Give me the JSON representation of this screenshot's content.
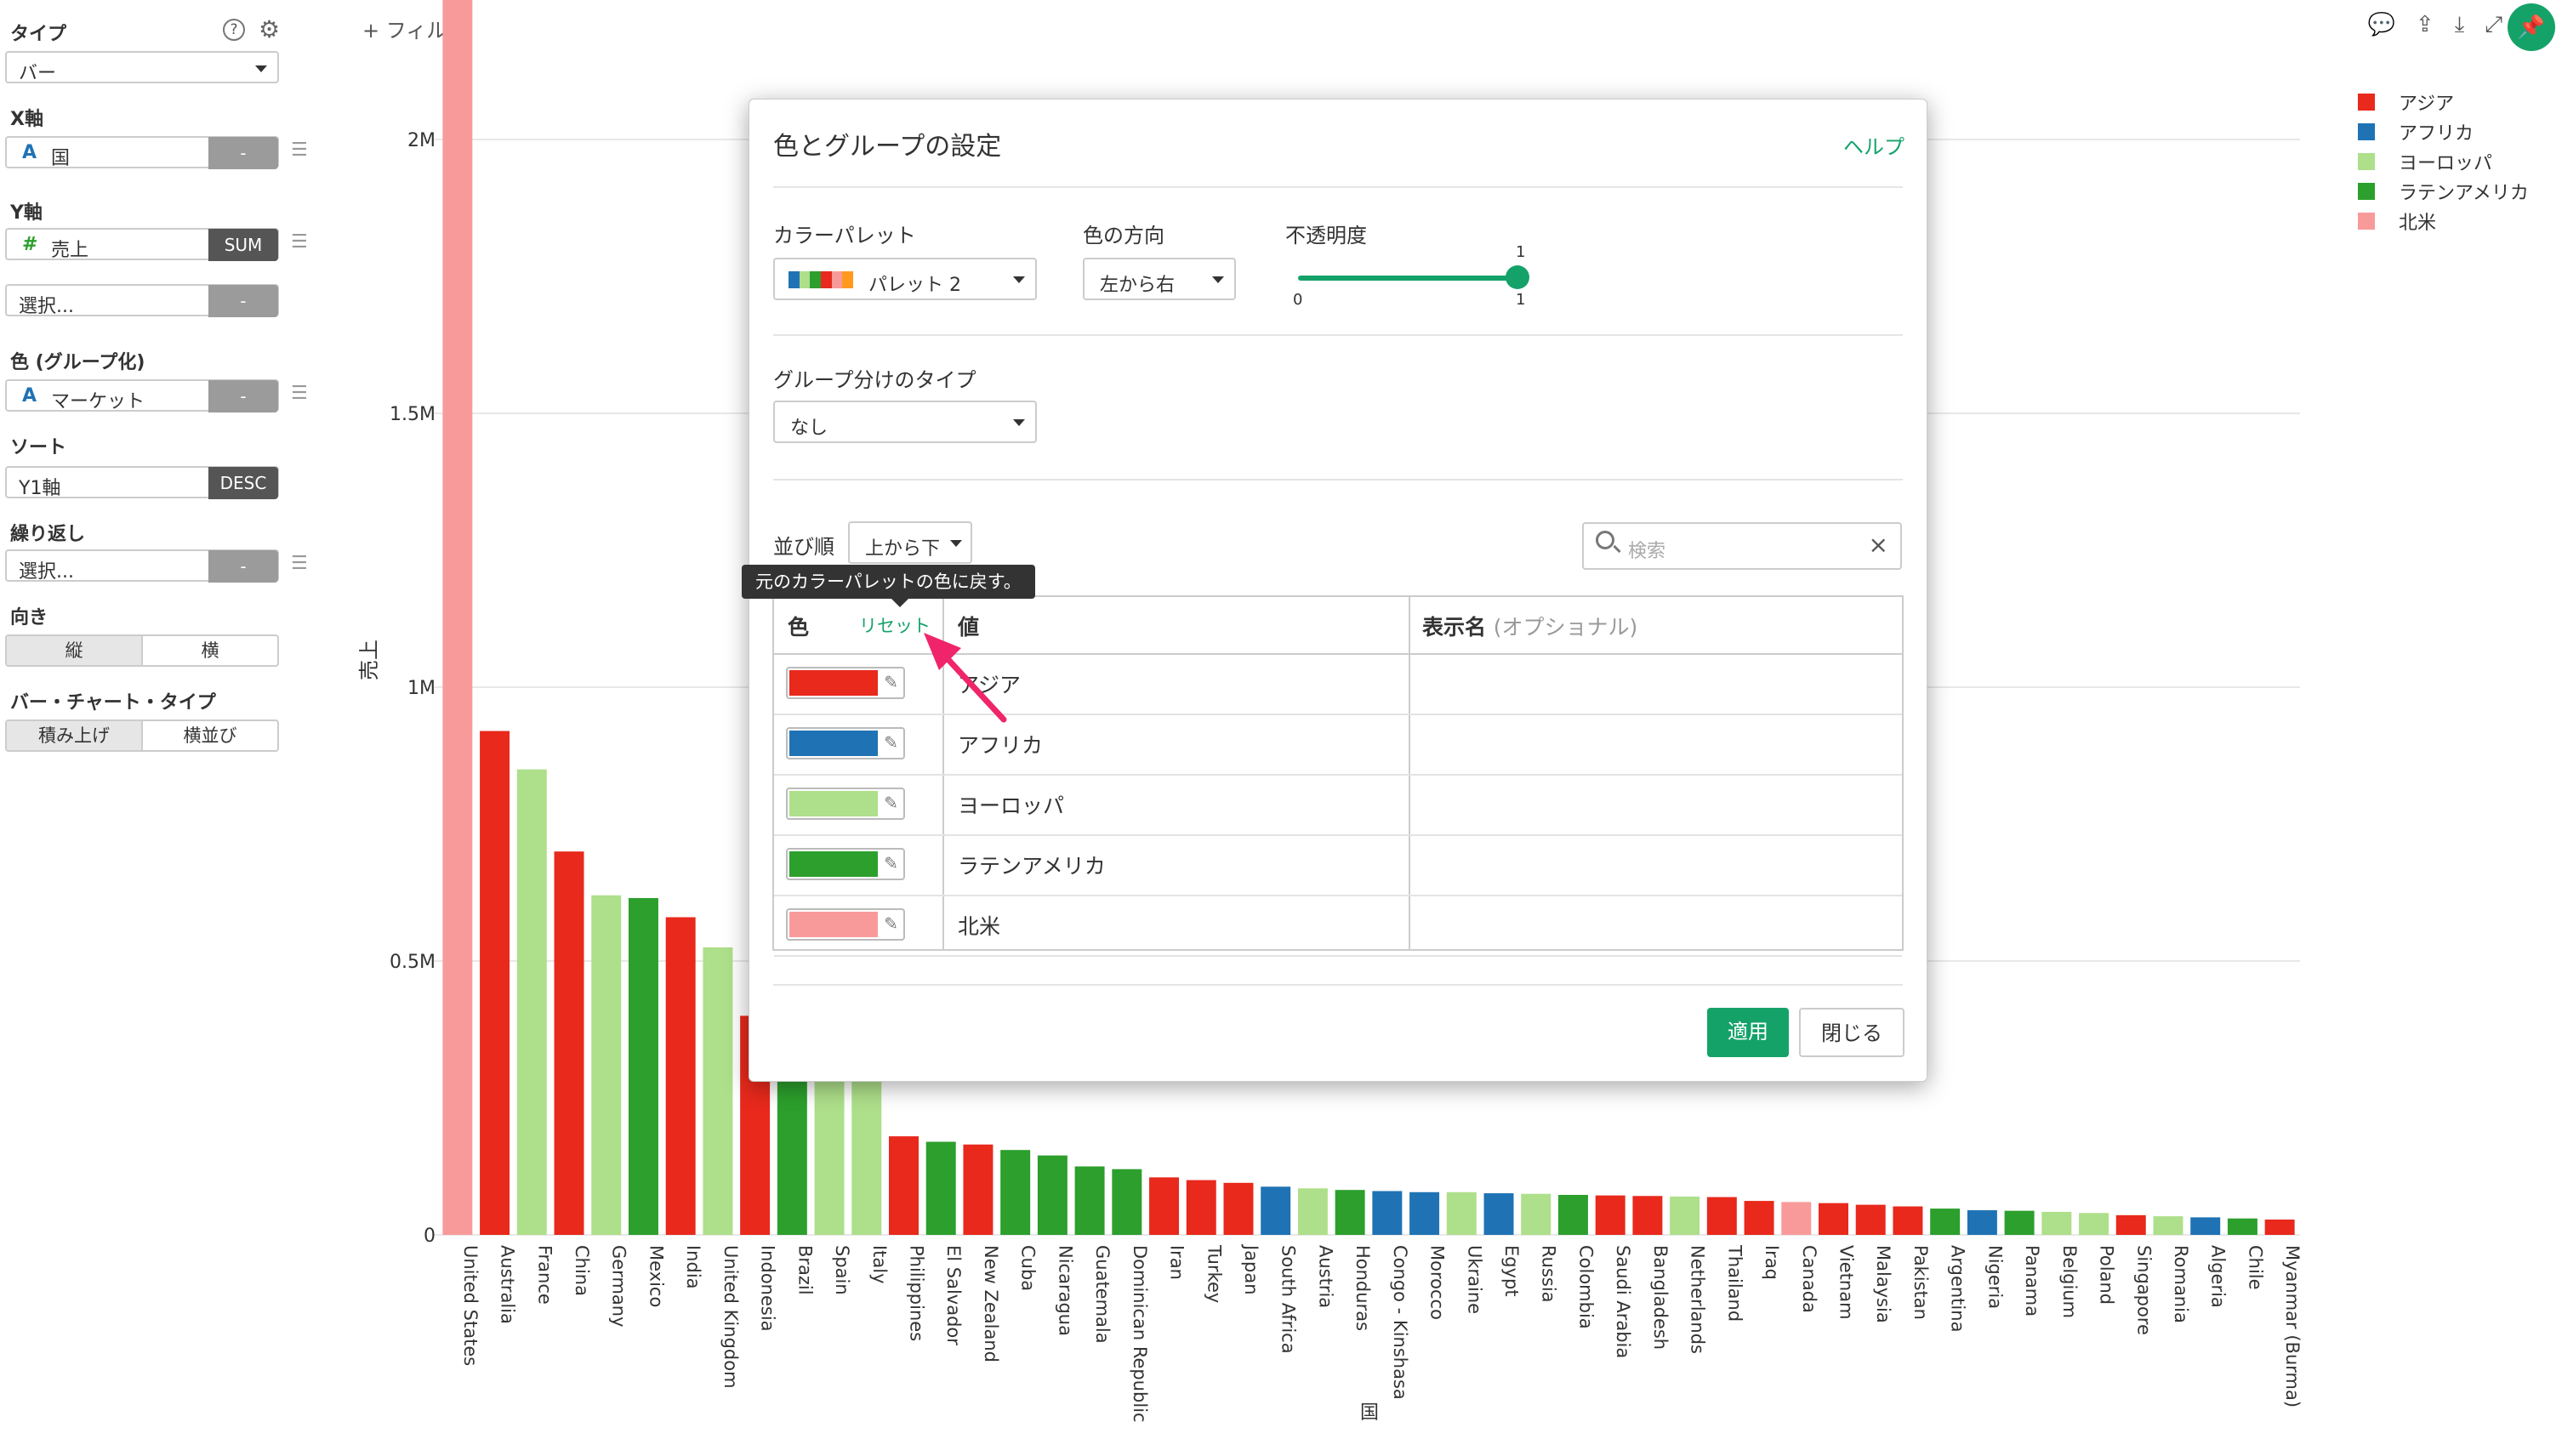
{
  "sidebar": {
    "type_label": "タイプ",
    "type_value": "バー",
    "help_icon": "?",
    "x_label": "X軸",
    "x_field": {
      "glyph": "A",
      "text": "国",
      "btn": "-"
    },
    "y_label": "Y軸",
    "y_field": {
      "glyph": "#",
      "text": "売上",
      "btn": "SUM"
    },
    "y2_field": {
      "text": "選択...",
      "btn": "-"
    },
    "color_label": "色 (グループ化)",
    "color_field": {
      "glyph": "A",
      "text": "マーケット",
      "btn": "-"
    },
    "sort_label": "ソート",
    "sort_field": {
      "text": "Y1軸",
      "btn": "DESC"
    },
    "repeat_label": "繰り返し",
    "repeat_field": {
      "text": "選択...",
      "btn": "-"
    },
    "orient_label": "向き",
    "orient_opts": [
      "縦",
      "横"
    ],
    "bartype_label": "バー・チャート・タイプ",
    "bartype_opts": [
      "積み上げ",
      "横並び"
    ]
  },
  "topbar": {
    "filter": "+ フィルタ"
  },
  "legend": [
    {
      "name": "アジア",
      "color": "#e8291c"
    },
    {
      "name": "アフリカ",
      "color": "#1f73b4"
    },
    {
      "name": "ヨーロッパ",
      "color": "#aedf8a"
    },
    {
      "name": "ラテンアメリカ",
      "color": "#2c9f2c"
    },
    {
      "name": "北米",
      "color": "#f99a9a"
    }
  ],
  "modal": {
    "title": "色とグループの設定",
    "help": "ヘルプ",
    "palette_label": "カラーパレット",
    "palette_value": "パレット 2",
    "palette_colors": [
      "#1f73b4",
      "#aedf8a",
      "#2c9f2c",
      "#e8291c",
      "#f99a9a",
      "#ff9a1f"
    ],
    "direction_label": "色の方向",
    "direction_value": "左から右",
    "opacity_label": "不透明度",
    "opacity_min": "0",
    "opacity_max": "1",
    "opacity_value": "1",
    "group_label": "グループ分けのタイプ",
    "group_value": "なし",
    "order_label": "並び順",
    "order_value": "上から下",
    "search_placeholder": "検索",
    "tooltip": "元のカラーパレットの色に戻す。",
    "table": {
      "col_color": "色",
      "reset": "リセット",
      "col_value": "値",
      "col_display": "表示名",
      "col_display_opt": "(オプショナル)",
      "rows": [
        {
          "color": "#e8291c",
          "value": "アジア"
        },
        {
          "color": "#1f73b4",
          "value": "アフリカ"
        },
        {
          "color": "#aedf8a",
          "value": "ヨーロッパ"
        },
        {
          "color": "#2c9f2c",
          "value": "ラテンアメリカ"
        },
        {
          "color": "#f99a9a",
          "value": "北米"
        }
      ]
    },
    "apply": "適用",
    "close": "閉じる"
  },
  "chart_data": {
    "type": "bar",
    "ylabel": "売上",
    "xlabel": "国",
    "yticks": [
      "0",
      "0.5M",
      "1M",
      "1.5M",
      "2M"
    ],
    "ylim": [
      0,
      2500000
    ],
    "categories": [
      "United States",
      "Australia",
      "France",
      "China",
      "Germany",
      "Mexico",
      "India",
      "United Kingdom",
      "Indonesia",
      "Brazil",
      "Spain",
      "Italy",
      "Philippines",
      "El Salvador",
      "New Zealand",
      "Cuba",
      "Nicaragua",
      "Guatemala",
      "Dominican Republic",
      "Iran",
      "Turkey",
      "Japan",
      "South Africa",
      "Austria",
      "Honduras",
      "Congo - Kinshasa",
      "Morocco",
      "Ukraine",
      "Egypt",
      "Russia",
      "Colombia",
      "Saudi Arabia",
      "Bangladesh",
      "Netherlands",
      "Thailand",
      "Iraq",
      "Canada",
      "Vietnam",
      "Malaysia",
      "Pakistan",
      "Argentina",
      "Nigeria",
      "Panama",
      "Belgium",
      "Poland",
      "Singapore",
      "Romania",
      "Algeria",
      "Chile",
      "Myanmar (Burma)"
    ],
    "values": [
      2300000,
      920000,
      850000,
      700000,
      620000,
      615000,
      580000,
      525000,
      400000,
      330000,
      285000,
      285000,
      180000,
      170000,
      165000,
      155000,
      145000,
      125000,
      120000,
      105000,
      100000,
      95000,
      88000,
      85000,
      82000,
      80000,
      78000,
      78000,
      76000,
      75000,
      73000,
      72000,
      71000,
      70000,
      69000,
      62000,
      60000,
      58000,
      55000,
      52000,
      48000,
      45000,
      44000,
      42000,
      40000,
      36000,
      34000,
      32000,
      30000,
      28000
    ],
    "groups": [
      "北米",
      "アジア",
      "ヨーロッパ",
      "アジア",
      "ヨーロッパ",
      "ラテンアメリカ",
      "アジア",
      "ヨーロッパ",
      "アジア",
      "ラテンアメリカ",
      "ヨーロッパ",
      "ヨーロッパ",
      "アジア",
      "ラテンアメリカ",
      "アジア",
      "ラテンアメリカ",
      "ラテンアメリカ",
      "ラテンアメリカ",
      "ラテンアメリカ",
      "アジア",
      "アジア",
      "アジア",
      "アフリカ",
      "ヨーロッパ",
      "ラテンアメリカ",
      "アフリカ",
      "アフリカ",
      "ヨーロッパ",
      "アフリカ",
      "ヨーロッパ",
      "ラテンアメリカ",
      "アジア",
      "アジア",
      "ヨーロッパ",
      "アジア",
      "アジア",
      "北米",
      "アジア",
      "アジア",
      "アジア",
      "ラテンアメリカ",
      "アフリカ",
      "ラテンアメリカ",
      "ヨーロッパ",
      "ヨーロッパ",
      "アジア",
      "ヨーロッパ",
      "アフリカ",
      "ラテンアメリカ",
      "アジア"
    ]
  }
}
